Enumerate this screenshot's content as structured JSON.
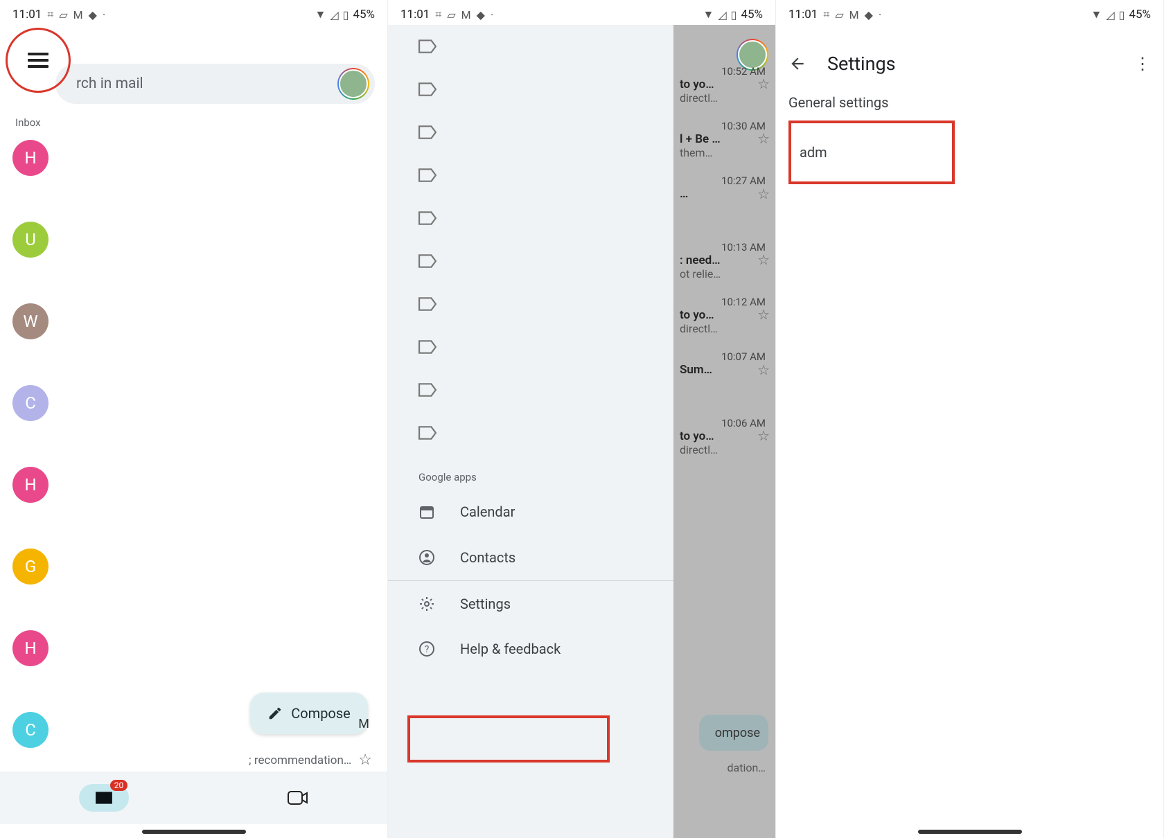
{
  "status": {
    "time": "11:01",
    "battery": "45%"
  },
  "panel1": {
    "search_placeholder": "rch in mail",
    "inbox_label": "Inbox",
    "compose_label": "Compose",
    "recommend_text": "; recommendation…",
    "letter_m": "M",
    "badge_count": "20",
    "senders": [
      {
        "letter": "H",
        "color": "#e9498a"
      },
      {
        "letter": "U",
        "color": "#9ccc3c"
      },
      {
        "letter": "W",
        "color": "#a58a7f"
      },
      {
        "letter": "C",
        "color": "#b3b3ea"
      },
      {
        "letter": "H",
        "color": "#e9498a"
      },
      {
        "letter": "G",
        "color": "#f5b400"
      },
      {
        "letter": "H",
        "color": "#e9498a"
      },
      {
        "letter": "C",
        "color": "#4dd0e1"
      }
    ]
  },
  "panel2": {
    "google_apps_label": "Google apps",
    "calendar_label": "Calendar",
    "contacts_label": "Contacts",
    "settings_label": "Settings",
    "help_label": "Help & feedback",
    "compose_label": "ompose",
    "recommend_text": "dation…",
    "snippets": [
      {
        "time": "10:52 AM",
        "l1": "to yo…",
        "l2": "directl…"
      },
      {
        "time": "10:30 AM",
        "l1": "l + Be …",
        "l2": "them…"
      },
      {
        "time": "10:27 AM",
        "l1": "…",
        "l2": ""
      },
      {
        "time": "10:13 AM",
        "l1": ": need…",
        "l2": "ot relie…"
      },
      {
        "time": "10:12 AM",
        "l1": "to yo…",
        "l2": "directl…"
      },
      {
        "time": "10:07 AM",
        "l1": "Sum…",
        "l2": ""
      },
      {
        "time": "10:06 AM",
        "l1": "to yo…",
        "l2": "directl…"
      }
    ]
  },
  "panel3": {
    "title": "Settings",
    "general": "General settings",
    "account": "adm"
  }
}
